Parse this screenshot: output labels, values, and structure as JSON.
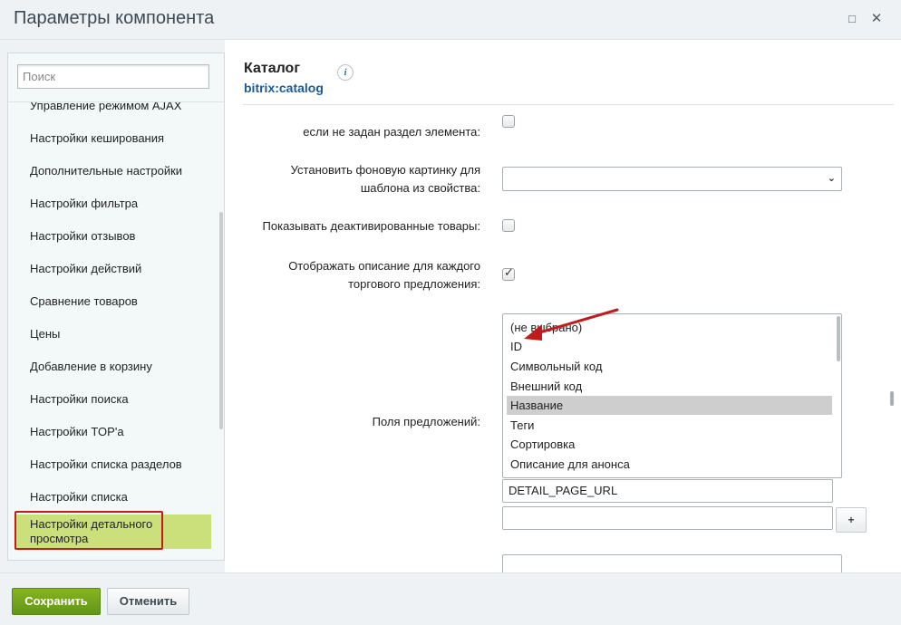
{
  "window": {
    "title": "Параметры компонента",
    "maximize_icon": "□",
    "close_icon": "✕"
  },
  "sidebar": {
    "search_placeholder": "Поиск",
    "items": [
      {
        "label": "Управление режимом AJAX"
      },
      {
        "label": "Настройки кеширования"
      },
      {
        "label": "Дополнительные настройки"
      },
      {
        "label": "Настройки фильтра"
      },
      {
        "label": "Настройки отзывов"
      },
      {
        "label": "Настройки действий"
      },
      {
        "label": "Сравнение товаров"
      },
      {
        "label": "Цены"
      },
      {
        "label": "Добавление в корзину"
      },
      {
        "label": "Настройки поиска"
      },
      {
        "label": "Настройки TOP'a"
      },
      {
        "label": "Настройки списка разделов"
      },
      {
        "label": "Настройки списка"
      },
      {
        "label": "Настройки детального просмотра",
        "active": true
      }
    ]
  },
  "component": {
    "title": "Каталог",
    "code": "bitrix:catalog",
    "info_icon": "i"
  },
  "form": {
    "row1_label": "если не задан раздел элемента:",
    "row1_checked": false,
    "row2_label_line1": "Установить фоновую картинку для",
    "row2_label_line2": "шаблона из свойства:",
    "row2_value": "",
    "row3_label": "Показывать деактивированные товары:",
    "row3_checked": false,
    "row4_label_line1": "Отображать описание для каждого",
    "row4_label_line2": "торгового предложения:",
    "row4_checked": true,
    "offers_label": "Поля предложений:",
    "offers_options": [
      {
        "label": "(не выбрано)",
        "selected": false
      },
      {
        "label": "ID",
        "selected": false
      },
      {
        "label": "Символьный код",
        "selected": false
      },
      {
        "label": "Внешний код",
        "selected": false
      },
      {
        "label": "Название",
        "selected": true
      },
      {
        "label": "Теги",
        "selected": false
      },
      {
        "label": "Сортировка",
        "selected": false
      },
      {
        "label": "Описание для анонса",
        "selected": false
      }
    ],
    "extra_field_1": "DETAIL_PAGE_URL",
    "extra_field_2": "",
    "add_button": "+"
  },
  "footer": {
    "save_label": "Сохранить",
    "cancel_label": "Отменить"
  },
  "colors": {
    "accent_green": "#6c9f1b",
    "active_item": "#cbe07b",
    "annotation_red": "#c21b1b",
    "link_blue": "#1a5a9b"
  }
}
